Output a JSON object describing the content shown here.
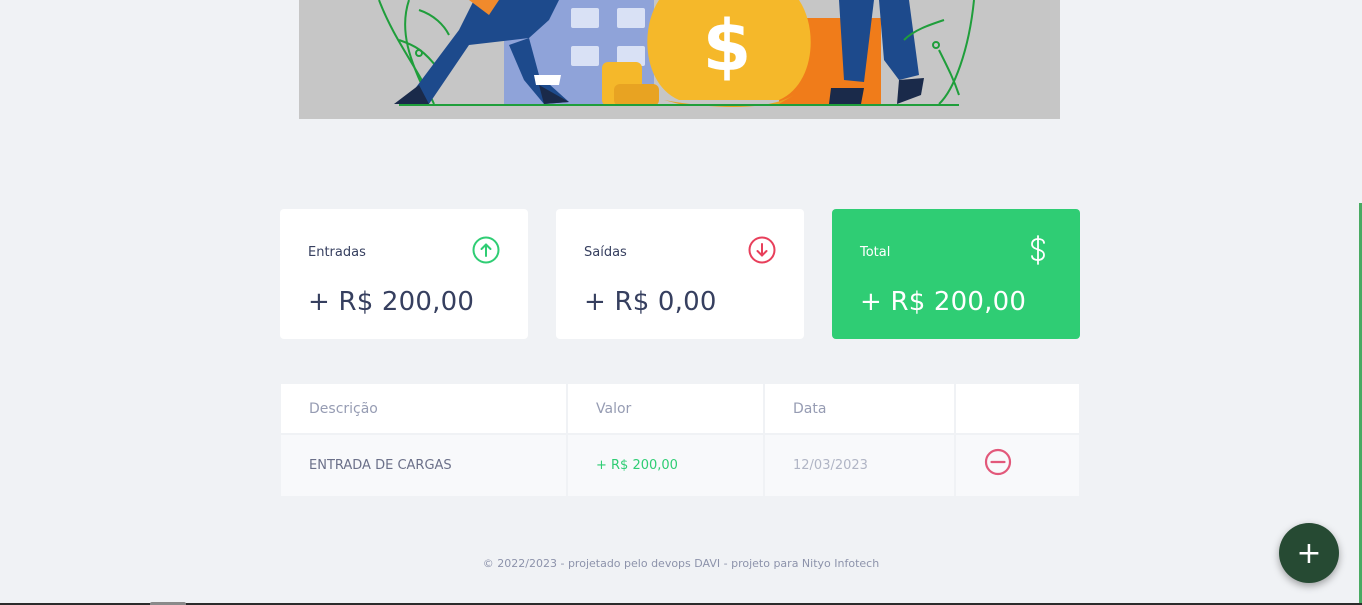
{
  "cards": {
    "income": {
      "label": "Entradas",
      "value": "+ R$ 200,00",
      "icon": "arrow-up-circle-icon",
      "color": "#2fcd74"
    },
    "expense": {
      "label": "Saídas",
      "value": "+ R$ 0,00",
      "icon": "arrow-down-circle-icon",
      "color": "#e83f5b"
    },
    "total": {
      "label": "Total",
      "value": "+ R$ 200,00",
      "icon": "dollar-sign-icon",
      "color": "#2fcd74"
    }
  },
  "table": {
    "headers": [
      "Descrição",
      "Valor",
      "Data",
      ""
    ],
    "rows": [
      {
        "description": "ENTRADA DE CARGAS",
        "amount": "+ R$ 200,00",
        "date": "12/03/2023",
        "action_icon": "minus-circle-icon"
      }
    ]
  },
  "footer": {
    "text": "© 2022/2023 - projetado pelo devops DAVI - projeto para Nityo Infotech"
  },
  "fab": {
    "label": "+",
    "icon": "plus-icon"
  },
  "colors": {
    "background": "#f0f2f5",
    "accent_green": "#2fcd74",
    "danger_red": "#e83f5b",
    "fab_dark_green": "#264a33"
  }
}
